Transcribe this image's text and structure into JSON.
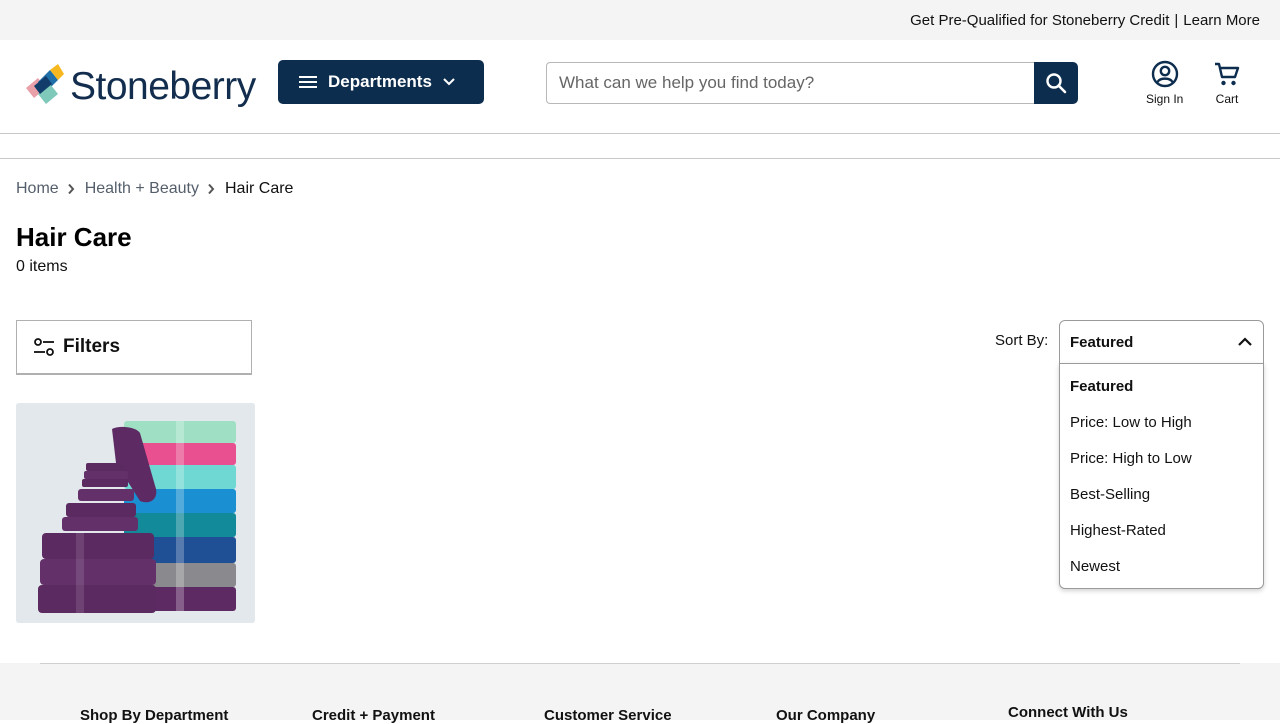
{
  "promo": {
    "text": "Get Pre-Qualified for Stoneberry Credit",
    "separator": "|",
    "link": "Learn More"
  },
  "header": {
    "logo_text": "Stoneberry",
    "departments_label": "Departments",
    "search_placeholder": "What can we help you find today?",
    "sign_in_label": "Sign In",
    "cart_label": "Cart"
  },
  "breadcrumb": {
    "items": [
      "Home",
      "Health + Beauty"
    ],
    "current": "Hair Care"
  },
  "page": {
    "title": "Hair Care",
    "count": "0 items"
  },
  "filters": {
    "label": "Filters"
  },
  "sort": {
    "label": "Sort By:",
    "selected": "Featured",
    "options": [
      "Featured",
      "Price: Low to High",
      "Price: High to Low",
      "Best-Selling",
      "Highest-Rated",
      "Newest"
    ]
  },
  "footer": {
    "columns": [
      "Shop By Department",
      "Credit + Payment",
      "Customer Service",
      "Our Company",
      "Connect With Us"
    ]
  },
  "colors": {
    "navy": "#0d2d4e",
    "logo_blue": "#1f6fa8",
    "logo_yellow": "#f6b81e",
    "logo_pink": "#e9a0a8",
    "logo_teal": "#7ec9b9"
  }
}
